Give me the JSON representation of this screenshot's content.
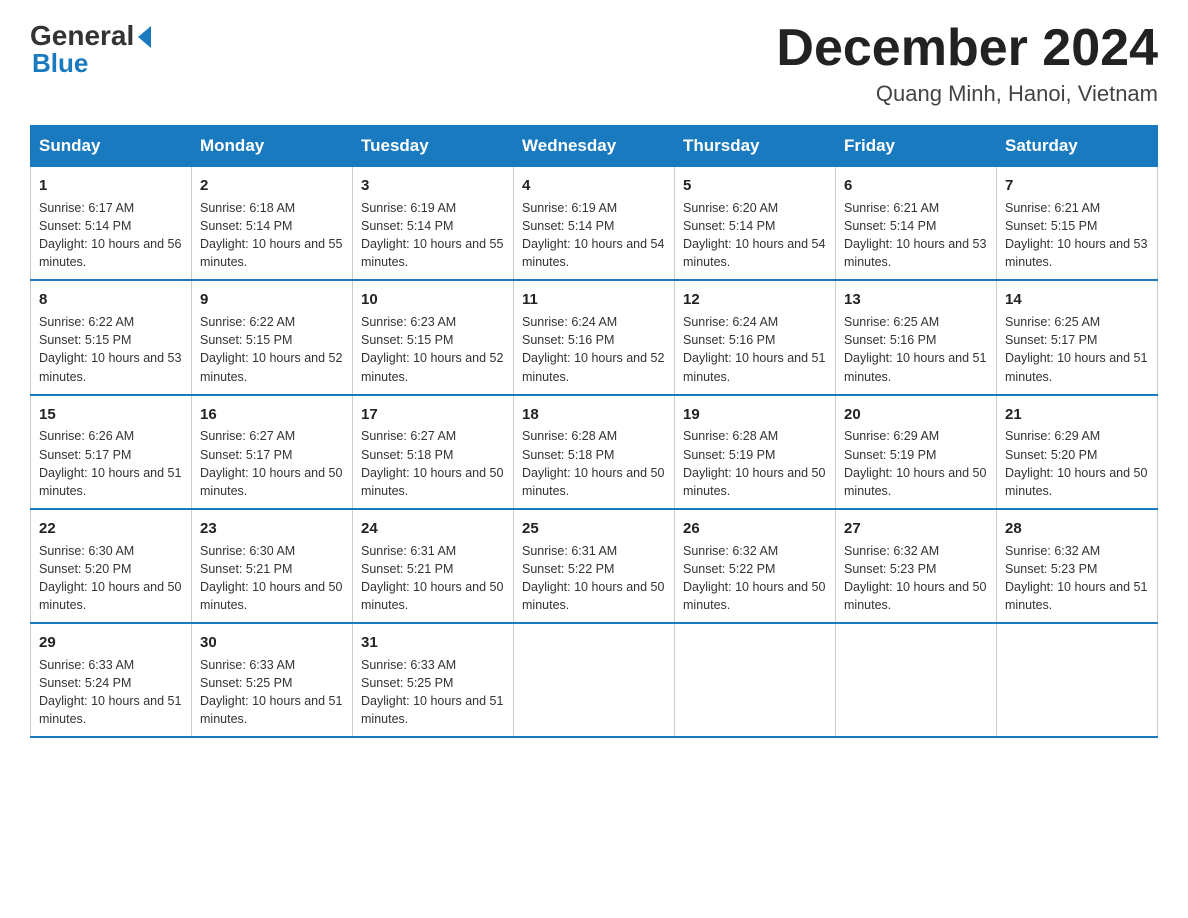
{
  "logo": {
    "general": "General",
    "triangle": "▶",
    "blue": "Blue"
  },
  "title": "December 2024",
  "subtitle": "Quang Minh, Hanoi, Vietnam",
  "headers": [
    "Sunday",
    "Monday",
    "Tuesday",
    "Wednesday",
    "Thursday",
    "Friday",
    "Saturday"
  ],
  "weeks": [
    [
      {
        "day": "1",
        "sunrise": "6:17 AM",
        "sunset": "5:14 PM",
        "daylight": "10 hours and 56 minutes."
      },
      {
        "day": "2",
        "sunrise": "6:18 AM",
        "sunset": "5:14 PM",
        "daylight": "10 hours and 55 minutes."
      },
      {
        "day": "3",
        "sunrise": "6:19 AM",
        "sunset": "5:14 PM",
        "daylight": "10 hours and 55 minutes."
      },
      {
        "day": "4",
        "sunrise": "6:19 AM",
        "sunset": "5:14 PM",
        "daylight": "10 hours and 54 minutes."
      },
      {
        "day": "5",
        "sunrise": "6:20 AM",
        "sunset": "5:14 PM",
        "daylight": "10 hours and 54 minutes."
      },
      {
        "day": "6",
        "sunrise": "6:21 AM",
        "sunset": "5:14 PM",
        "daylight": "10 hours and 53 minutes."
      },
      {
        "day": "7",
        "sunrise": "6:21 AM",
        "sunset": "5:15 PM",
        "daylight": "10 hours and 53 minutes."
      }
    ],
    [
      {
        "day": "8",
        "sunrise": "6:22 AM",
        "sunset": "5:15 PM",
        "daylight": "10 hours and 53 minutes."
      },
      {
        "day": "9",
        "sunrise": "6:22 AM",
        "sunset": "5:15 PM",
        "daylight": "10 hours and 52 minutes."
      },
      {
        "day": "10",
        "sunrise": "6:23 AM",
        "sunset": "5:15 PM",
        "daylight": "10 hours and 52 minutes."
      },
      {
        "day": "11",
        "sunrise": "6:24 AM",
        "sunset": "5:16 PM",
        "daylight": "10 hours and 52 minutes."
      },
      {
        "day": "12",
        "sunrise": "6:24 AM",
        "sunset": "5:16 PM",
        "daylight": "10 hours and 51 minutes."
      },
      {
        "day": "13",
        "sunrise": "6:25 AM",
        "sunset": "5:16 PM",
        "daylight": "10 hours and 51 minutes."
      },
      {
        "day": "14",
        "sunrise": "6:25 AM",
        "sunset": "5:17 PM",
        "daylight": "10 hours and 51 minutes."
      }
    ],
    [
      {
        "day": "15",
        "sunrise": "6:26 AM",
        "sunset": "5:17 PM",
        "daylight": "10 hours and 51 minutes."
      },
      {
        "day": "16",
        "sunrise": "6:27 AM",
        "sunset": "5:17 PM",
        "daylight": "10 hours and 50 minutes."
      },
      {
        "day": "17",
        "sunrise": "6:27 AM",
        "sunset": "5:18 PM",
        "daylight": "10 hours and 50 minutes."
      },
      {
        "day": "18",
        "sunrise": "6:28 AM",
        "sunset": "5:18 PM",
        "daylight": "10 hours and 50 minutes."
      },
      {
        "day": "19",
        "sunrise": "6:28 AM",
        "sunset": "5:19 PM",
        "daylight": "10 hours and 50 minutes."
      },
      {
        "day": "20",
        "sunrise": "6:29 AM",
        "sunset": "5:19 PM",
        "daylight": "10 hours and 50 minutes."
      },
      {
        "day": "21",
        "sunrise": "6:29 AM",
        "sunset": "5:20 PM",
        "daylight": "10 hours and 50 minutes."
      }
    ],
    [
      {
        "day": "22",
        "sunrise": "6:30 AM",
        "sunset": "5:20 PM",
        "daylight": "10 hours and 50 minutes."
      },
      {
        "day": "23",
        "sunrise": "6:30 AM",
        "sunset": "5:21 PM",
        "daylight": "10 hours and 50 minutes."
      },
      {
        "day": "24",
        "sunrise": "6:31 AM",
        "sunset": "5:21 PM",
        "daylight": "10 hours and 50 minutes."
      },
      {
        "day": "25",
        "sunrise": "6:31 AM",
        "sunset": "5:22 PM",
        "daylight": "10 hours and 50 minutes."
      },
      {
        "day": "26",
        "sunrise": "6:32 AM",
        "sunset": "5:22 PM",
        "daylight": "10 hours and 50 minutes."
      },
      {
        "day": "27",
        "sunrise": "6:32 AM",
        "sunset": "5:23 PM",
        "daylight": "10 hours and 50 minutes."
      },
      {
        "day": "28",
        "sunrise": "6:32 AM",
        "sunset": "5:23 PM",
        "daylight": "10 hours and 51 minutes."
      }
    ],
    [
      {
        "day": "29",
        "sunrise": "6:33 AM",
        "sunset": "5:24 PM",
        "daylight": "10 hours and 51 minutes."
      },
      {
        "day": "30",
        "sunrise": "6:33 AM",
        "sunset": "5:25 PM",
        "daylight": "10 hours and 51 minutes."
      },
      {
        "day": "31",
        "sunrise": "6:33 AM",
        "sunset": "5:25 PM",
        "daylight": "10 hours and 51 minutes."
      },
      null,
      null,
      null,
      null
    ]
  ]
}
